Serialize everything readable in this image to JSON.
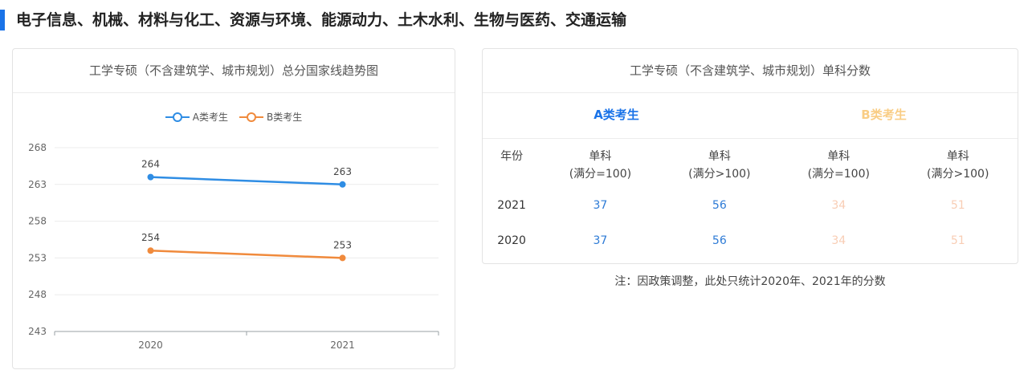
{
  "heading": "电子信息、机械、材料与化工、资源与环境、能源动力、土木水利、生物与医药、交通运输",
  "left_card": {
    "title": "工学专硕（不含建筑学、城市规划）总分国家线趋势图"
  },
  "chart_data": {
    "type": "line",
    "title": "工学专硕（不含建筑学、城市规划）总分国家线趋势图",
    "x": [
      "2020",
      "2021"
    ],
    "yticks": [
      243,
      248,
      253,
      258,
      263,
      268
    ],
    "ylim": [
      243,
      268
    ],
    "grid": true,
    "legend_position": "top-center",
    "series": [
      {
        "name": "A类考生",
        "values": [
          264,
          263
        ],
        "color": "#2f8de4"
      },
      {
        "name": "B类考生",
        "values": [
          254,
          253
        ],
        "color": "#f08a3c"
      }
    ]
  },
  "right_card": {
    "title": "工学专硕（不含建筑学、城市规划）单科分数",
    "tabs": [
      "A类考生",
      "B类考生"
    ],
    "columns": [
      {
        "line1": "年份",
        "line2": ""
      },
      {
        "line1": "单科",
        "line2": "(满分=100)"
      },
      {
        "line1": "单科",
        "line2": "(满分>100)"
      },
      {
        "line1": "单科",
        "line2": "(满分=100)"
      },
      {
        "line1": "单科",
        "line2": "(满分>100)"
      }
    ],
    "rows": [
      [
        "2021",
        "37",
        "56",
        "34",
        "51"
      ],
      [
        "2020",
        "37",
        "56",
        "34",
        "51"
      ]
    ],
    "note": "注：因政策调整，此处只统计2020年、2021年的分数"
  },
  "colors": {
    "accent": "#1a73e8",
    "series_a": "#2f8de4",
    "series_b": "#f08a3c"
  }
}
